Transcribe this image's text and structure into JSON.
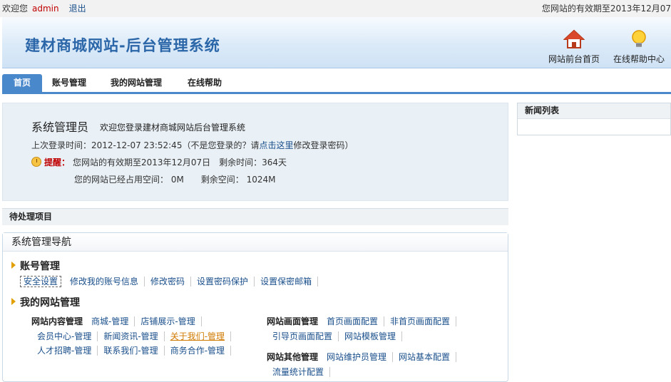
{
  "topbar": {
    "welcome": "欢迎您",
    "user": "admin",
    "logout": "退出",
    "expiry": "您网站的有效期至2013年12月07"
  },
  "header": {
    "title": "建材商城网站-后台管理系统",
    "home_btn": "网站前台首页",
    "help_btn": "在线帮助中心"
  },
  "nav": {
    "tabs": [
      "首页",
      "账号管理",
      "我的网站管理",
      "在线帮助"
    ]
  },
  "welcome": {
    "role": "系统管理员",
    "message": "欢迎您登录建材商城网站后台管理系统",
    "last_login_prefix": "上次登录时间：2012-12-07 23:52:45（不是您登录的？请",
    "last_login_link": "点击这里",
    "last_login_suffix": "修改登录密码）",
    "warn_label": "提醒：",
    "warn_text": "您网站的有效期至2013年12月07日　剩余时间：364天",
    "space_text": "您的网站已经占用空间：  0M　　剩余空间：  1024M"
  },
  "pending": {
    "title": "待处理项目"
  },
  "sysnav": {
    "title": "系统管理导航",
    "account": {
      "title": "账号管理",
      "links": [
        "安全设置",
        "修改我的账号信息",
        "修改密码",
        "设置密码保护",
        "设置保密邮箱"
      ]
    },
    "site": {
      "title": "我的网站管理",
      "content": {
        "group": "网站内容管理",
        "row1": [
          "商城-管理",
          "店铺展示-管理"
        ],
        "row2": [
          "会员中心-管理",
          "新闻资讯-管理",
          "关于我们-管理"
        ],
        "row3": [
          "人才招聘-管理",
          "联系我们-管理",
          "商务合作-管理"
        ]
      },
      "screen": {
        "group": "网站画面管理",
        "row1": [
          "首页画面配置",
          "非首页画面配置"
        ],
        "row2": [
          "引导页画面配置",
          "网站模板管理"
        ]
      },
      "other": {
        "group": "网站其他管理",
        "row1": [
          "网站维护员管理",
          "网站基本配置"
        ],
        "row2": [
          "流量统计配置"
        ]
      }
    }
  },
  "news": {
    "title": "新闻列表"
  }
}
